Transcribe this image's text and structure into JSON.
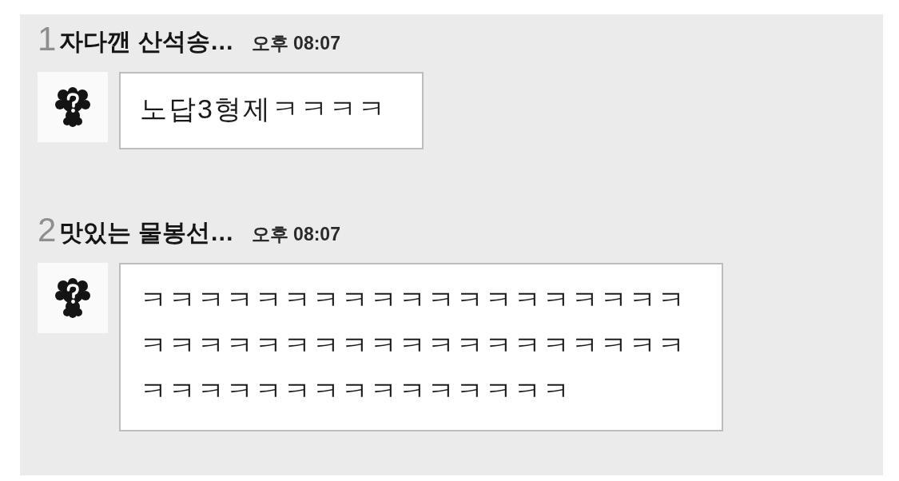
{
  "messages": [
    {
      "index": "1",
      "sender": "자다깬 산석송…",
      "time": "오후 08:07",
      "lines": [
        "노답3형제ㅋㅋㅋㅋ"
      ]
    },
    {
      "index": "2",
      "sender": "맛있는 물봉선…",
      "time": "오후 08:07",
      "lines": [
        "ㅋㅋㅋㅋㅋㅋㅋㅋㅋㅋㅋㅋㅋㅋㅋㅋㅋㅋㅋ",
        "ㅋㅋㅋㅋㅋㅋㅋㅋㅋㅋㅋㅋㅋㅋㅋㅋㅋㅋㅋ",
        "ㅋㅋㅋㅋㅋㅋㅋㅋㅋㅋㅋㅋㅋㅋㅋ"
      ]
    }
  ]
}
